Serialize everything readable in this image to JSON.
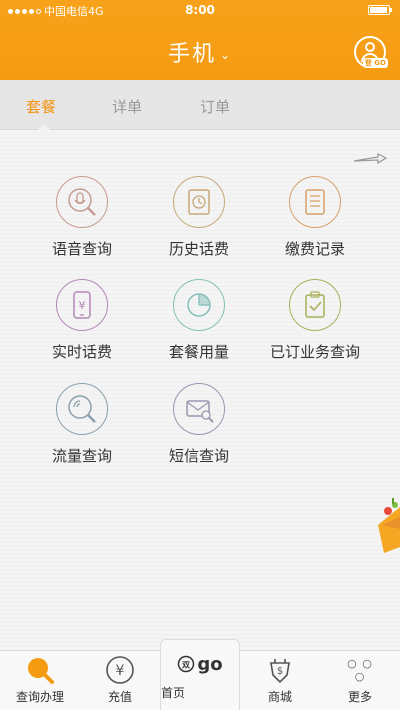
{
  "status_bar": {
    "carrier": "中国电信4G",
    "time": "8:00"
  },
  "header": {
    "title": "手机",
    "chevron": "⌄",
    "avatar_tag": "登 GO"
  },
  "tabs": [
    {
      "label": "套餐",
      "active": true
    },
    {
      "label": "详单",
      "active": false
    },
    {
      "label": "订单",
      "active": false
    }
  ],
  "grid": [
    {
      "label": "语音查询",
      "icon": "voice-search-icon",
      "color": "#c89a90"
    },
    {
      "label": "历史话费",
      "icon": "history-bill-icon",
      "color": "#c7a978"
    },
    {
      "label": "缴费记录",
      "icon": "payment-record-icon",
      "color": "#d9a06a"
    },
    {
      "label": "实时话费",
      "icon": "realtime-bill-icon",
      "color": "#b387b8"
    },
    {
      "label": "套餐用量",
      "icon": "package-usage-icon",
      "color": "#86bfb8"
    },
    {
      "label": "已订业务查询",
      "icon": "subscribed-service-icon",
      "color": "#aab05c"
    },
    {
      "label": "流量查询",
      "icon": "data-flow-icon",
      "color": "#8aa0ad"
    },
    {
      "label": "短信查询",
      "icon": "sms-search-icon",
      "color": "#9b95b0"
    }
  ],
  "bottom_nav": [
    {
      "label": "查询办理",
      "icon": "search-icon"
    },
    {
      "label": "充值",
      "icon": "recharge-icon"
    },
    {
      "label": "首页",
      "icon": "go-home-icon",
      "logo_text": "go"
    },
    {
      "label": "商城",
      "icon": "mall-icon"
    },
    {
      "label": "更多",
      "icon": "more-icon",
      "glyph": "○ ○ ○"
    }
  ],
  "colors": {
    "accent": "#f59b12",
    "active_tab": "#f29313"
  }
}
